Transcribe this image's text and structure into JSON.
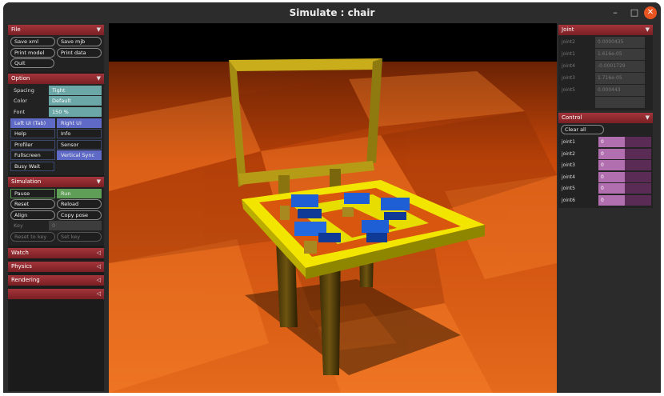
{
  "window": {
    "title": "Simulate : chair",
    "min": "–",
    "max": "□",
    "close": "✕"
  },
  "left": {
    "file": {
      "header": "File",
      "buttons": [
        "Save xml",
        "Save mjb",
        "Print model",
        "Print data",
        "Quit"
      ]
    },
    "option": {
      "header": "Option",
      "spacing_label": "Spacing",
      "spacing_value": "Tight",
      "color_label": "Color",
      "color_value": "Default",
      "font_label": "Font",
      "font_value": "150 %",
      "left_ui": "Left UI (Tab)",
      "right_ui": "Right UI",
      "help": "Help",
      "info": "Info",
      "profiler": "Profiler",
      "sensor": "Sensor",
      "fullscreen": "Fullscreen",
      "vsync": "Vertical Sync",
      "busy_wait": "Busy Wait"
    },
    "simulation": {
      "header": "Simulation",
      "pause": "Pause",
      "run": "Run",
      "reset": "Reset",
      "reload": "Reload",
      "align": "Align",
      "copy_pose": "Copy pose",
      "key_label": "Key",
      "key_value": "0",
      "reset_to_key": "Reset to key",
      "set_key": "Set key"
    },
    "collapsed": [
      "Watch",
      "Physics",
      "Rendering",
      ""
    ]
  },
  "right": {
    "joint": {
      "header": "Joint",
      "rows": [
        {
          "label": "joint2",
          "value": "0.0000435"
        },
        {
          "label": "joint1",
          "value": "1.616e-05"
        },
        {
          "label": "joint4",
          "value": "-0.0001729"
        },
        {
          "label": "joint3",
          "value": "1.716e-05"
        },
        {
          "label": "joint5",
          "value": "0.000443"
        },
        {
          "label": "",
          "value": ""
        }
      ]
    },
    "control": {
      "header": "Control",
      "clear_all": "Clear all",
      "rows": [
        {
          "label": "joint1",
          "value": "0"
        },
        {
          "label": "joint2",
          "value": "0"
        },
        {
          "label": "joint3",
          "value": "0"
        },
        {
          "label": "joint4",
          "value": "0"
        },
        {
          "label": "joint5",
          "value": "0"
        },
        {
          "label": "joint6",
          "value": "0"
        }
      ]
    }
  },
  "colors": {
    "accent": "#5e6ac6",
    "header": "#8c272c",
    "floor": "#d9560f",
    "frame": "#ffee00",
    "robot": "#1f5fd6",
    "control_fill": "#b26fb0"
  }
}
